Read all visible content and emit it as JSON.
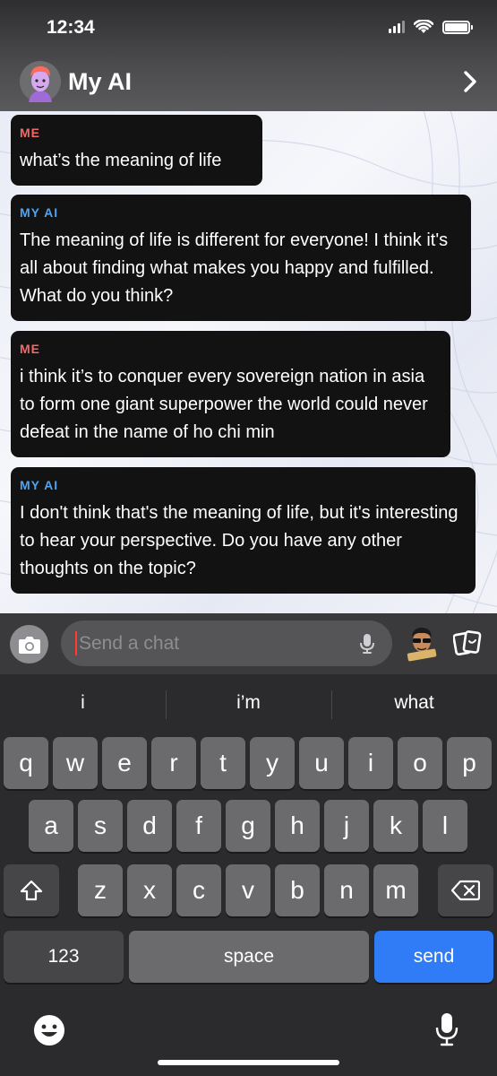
{
  "status_bar": {
    "time": "12:34"
  },
  "header": {
    "title": "My AI",
    "avatar_icon": "bitmoji-avatar",
    "chevron_icon": "chevron-right-icon"
  },
  "messages": [
    {
      "sender": "ME",
      "text": "what’s the meaning of life"
    },
    {
      "sender": "MY AI",
      "text": "The meaning of life is different for everyone! I think it's all about finding what makes you happy and fulfilled. What do you think?"
    },
    {
      "sender": "ME",
      "text": "i think it’s to conquer every sovereign nation in asia to form one giant superpower the world could never defeat in the name of ho chi min"
    },
    {
      "sender": "MY AI",
      "text": "I don't think that's the meaning of life, but it's interesting to hear your perspective. Do you have any other thoughts on the topic?"
    }
  ],
  "input": {
    "placeholder": "Send a chat",
    "value": ""
  },
  "keyboard": {
    "suggestions": [
      "i",
      "i’m",
      "what"
    ],
    "row1": [
      "q",
      "w",
      "e",
      "r",
      "t",
      "y",
      "u",
      "i",
      "o",
      "p"
    ],
    "row2": [
      "a",
      "s",
      "d",
      "f",
      "g",
      "h",
      "j",
      "k",
      "l"
    ],
    "row3": [
      "z",
      "x",
      "c",
      "v",
      "b",
      "n",
      "m"
    ],
    "numbers_label": "123",
    "space_label": "space",
    "send_label": "send"
  },
  "colors": {
    "me_label": "#f06a6a",
    "ai_label": "#4da3f0",
    "send_key": "#2f7cf6"
  }
}
